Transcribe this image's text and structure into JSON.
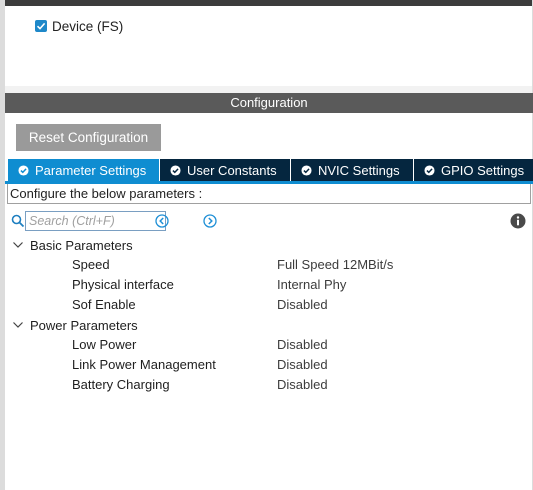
{
  "mode": {
    "device_label": "Device (FS)",
    "device_checked": true
  },
  "configuration": {
    "header": "Configuration",
    "reset_button": "Reset Configuration",
    "tabs": [
      {
        "label": "Parameter Settings",
        "active": true
      },
      {
        "label": "User Constants",
        "active": false
      },
      {
        "label": "NVIC Settings",
        "active": false
      },
      {
        "label": "GPIO Settings",
        "active": false
      }
    ],
    "configure_label": "Configure the below parameters :",
    "search": {
      "placeholder": "Search (Ctrl+F)",
      "value": ""
    },
    "groups": [
      {
        "name": "Basic Parameters",
        "params": [
          {
            "name": "Speed",
            "value": "Full Speed 12MBit/s"
          },
          {
            "name": "Physical interface",
            "value": "Internal Phy"
          },
          {
            "name": "Sof Enable",
            "value": "Disabled"
          }
        ]
      },
      {
        "name": "Power Parameters",
        "params": [
          {
            "name": "Low Power",
            "value": "Disabled"
          },
          {
            "name": "Link Power Management",
            "value": "Disabled"
          },
          {
            "name": "Battery Charging",
            "value": "Disabled"
          }
        ]
      }
    ]
  },
  "colors": {
    "accent": "#0f8dd1",
    "tab_dark": "#05263f",
    "header_bg": "#5a5a5a",
    "button_bg": "#9a9a9a"
  },
  "icons": {
    "check": "check-circle-icon",
    "search": "search-icon",
    "prev": "arrow-left-circle-icon",
    "next": "arrow-right-circle-icon",
    "info": "info-icon",
    "chevron": "chevron-down-icon"
  }
}
